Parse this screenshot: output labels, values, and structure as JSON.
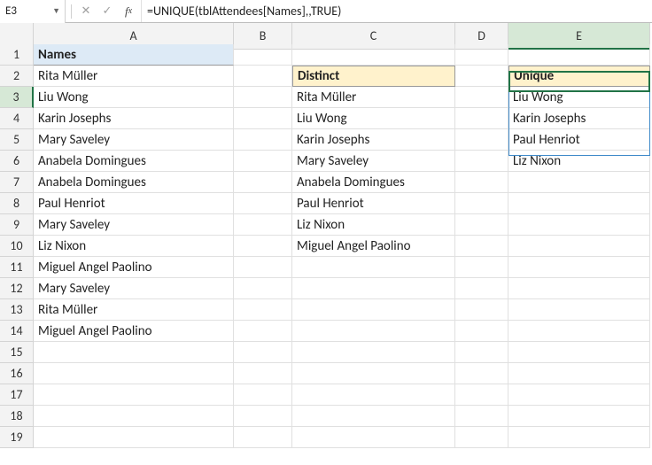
{
  "nameBox": "E3",
  "formula": "=UNIQUE(tblAttendees[Names],,TRUE)",
  "columns": [
    "A",
    "B",
    "C",
    "D",
    "E"
  ],
  "rowCount": 19,
  "headers": {
    "A1": "Names",
    "C2": "Distinct",
    "E2": "Unique"
  },
  "colA": [
    "Rita Müller",
    "Liu Wong",
    "Karin Josephs",
    "Mary Saveley",
    "Anabela Domingues",
    "Anabela Domingues",
    "Paul Henriot",
    "Mary Saveley",
    "Liz Nixon",
    "Miguel Angel Paolino",
    "Mary Saveley",
    "Rita Müller",
    "Miguel Angel Paolino"
  ],
  "colC": [
    "Rita Müller",
    "Liu Wong",
    "Karin Josephs",
    "Mary Saveley",
    "Anabela Domingues",
    "Paul Henriot",
    "Liz Nixon",
    "Miguel Angel Paolino"
  ],
  "colE": [
    "Liu Wong",
    "Karin Josephs",
    "Paul Henriot",
    "Liz Nixon"
  ]
}
